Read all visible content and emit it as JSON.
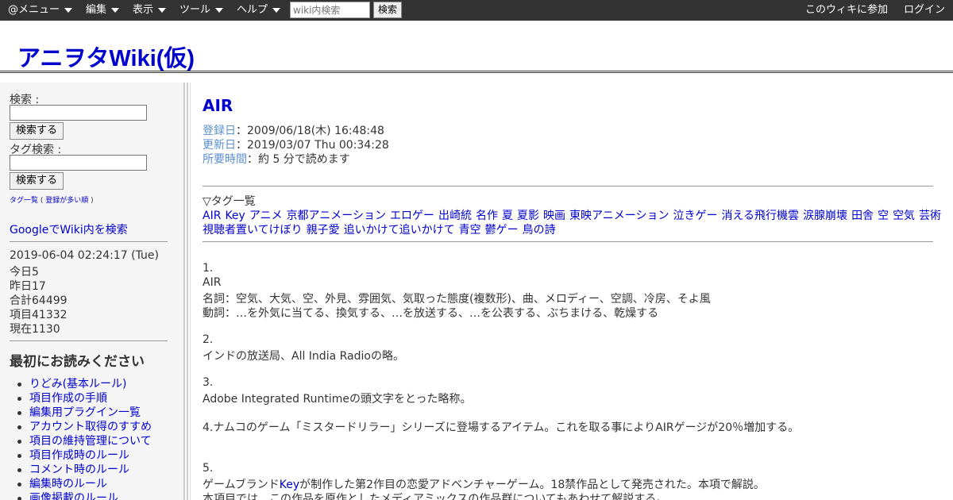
{
  "topbar": {
    "menus": [
      "@メニュー",
      "編集",
      "表示",
      "ツール",
      "ヘルプ"
    ],
    "search_placeholder": "wiki内検索",
    "search_button": "検索",
    "join": "このウィキに参加",
    "login": "ログイン"
  },
  "header": {
    "title": "アニヲタWiki(仮)"
  },
  "sidebar": {
    "search_label": "検索 :",
    "search_button": "検索する",
    "tag_search_label": "タグ検索 :",
    "tag_search_button": "検索する",
    "tag_list_link": "タグ一覧",
    "tag_list_paren_open": "(",
    "tag_list_popular": "登録が多い順",
    "tag_list_paren_close": ")",
    "google_search": "GoogleでWiki内を検索",
    "stats": [
      "2019-06-04 02:24:17 (Tue)",
      "今日5",
      "昨日17",
      "合計64499",
      "項目41332",
      "現在1130"
    ],
    "read_first_heading": "最初にお読みください",
    "read_first_items": [
      "りどみ(基本ルール)",
      "項目作成の手順",
      "編集用プラグイン一覧",
      "アカウント取得のすすめ",
      "項目の維持管理について",
      "項目作成時のルール",
      "コメント時のルール",
      "編集時のルール",
      "画像掲載のルール"
    ]
  },
  "main": {
    "title": "AIR",
    "meta": [
      {
        "key": "登録日",
        "sep": "：",
        "value": "2009/06/18(木) 16:48:48"
      },
      {
        "key": "更新日",
        "sep": "：",
        "value": "2019/03/07 Thu 00:34:28"
      },
      {
        "key": "所要時間",
        "sep": "：",
        "value": "約 5 分で読めます"
      }
    ],
    "tag_heading": "▽タグ一覧",
    "tags_line1": [
      "AIR",
      "Key",
      "アニメ",
      "京都アニメーション",
      "エロゲー",
      "出崎統",
      "名作",
      "夏",
      "夏影",
      "映画",
      "東映アニメーション",
      "泣きゲー",
      "消える飛行機雲",
      "涙腺崩壊",
      "田舎",
      "空",
      "空気",
      "芸術"
    ],
    "tags_line2": [
      "視聴者置いてけぼり",
      "親子愛",
      "追いかけて追いかけて",
      "青空",
      "鬱ゲー",
      "鳥の詩"
    ],
    "body": {
      "s1_num": "1.",
      "s1_word": "AIR",
      "s1_noun": "名詞：空気、大気、空、外見、雰囲気、気取った態度(複数形)、曲、メロディー、空調、冷房、そよ風",
      "s1_verb": "動詞：…を外気に当てる、換気する、…を放送する、…を公表する、ぶちまける、乾燥する",
      "s2_num": "2.",
      "s2_text": "インドの放送局、All India Radioの略。",
      "s3_num": "3.",
      "s3_text": "Adobe Integrated Runtimeの頭文字をとった略称。",
      "s4_text": "4.ナムコのゲーム「ミスタードリラー」シリーズに登場するアイテム。これを取る事によりAIRゲージが20％増加する。",
      "s5_num": "5.",
      "s5_pre": "ゲームブランド",
      "s5_link": "Key",
      "s5_post": "が制作した第2作目の恋愛アドベンチャーゲーム。18禁作品として発売された。本項で解説。",
      "s5_line2": "本項目では、この作品を原作としたメディアミックスの作品群についてもあわせて解説する。"
    }
  }
}
